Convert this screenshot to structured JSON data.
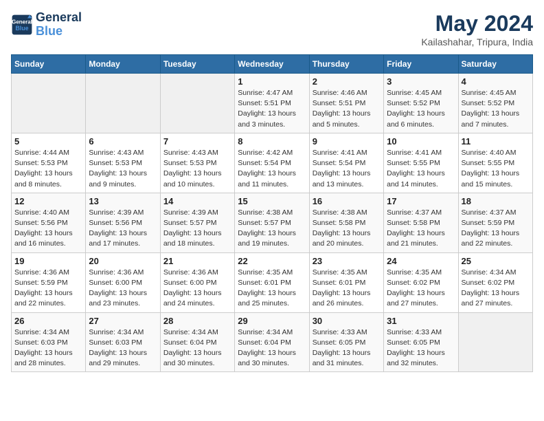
{
  "header": {
    "logo_line1": "General",
    "logo_line2": "Blue",
    "month_year": "May 2024",
    "location": "Kailashahar, Tripura, India"
  },
  "days_of_week": [
    "Sunday",
    "Monday",
    "Tuesday",
    "Wednesday",
    "Thursday",
    "Friday",
    "Saturday"
  ],
  "weeks": [
    [
      {
        "day": "",
        "info": ""
      },
      {
        "day": "",
        "info": ""
      },
      {
        "day": "",
        "info": ""
      },
      {
        "day": "1",
        "info": "Sunrise: 4:47 AM\nSunset: 5:51 PM\nDaylight: 13 hours and 3 minutes."
      },
      {
        "day": "2",
        "info": "Sunrise: 4:46 AM\nSunset: 5:51 PM\nDaylight: 13 hours and 5 minutes."
      },
      {
        "day": "3",
        "info": "Sunrise: 4:45 AM\nSunset: 5:52 PM\nDaylight: 13 hours and 6 minutes."
      },
      {
        "day": "4",
        "info": "Sunrise: 4:45 AM\nSunset: 5:52 PM\nDaylight: 13 hours and 7 minutes."
      }
    ],
    [
      {
        "day": "5",
        "info": "Sunrise: 4:44 AM\nSunset: 5:53 PM\nDaylight: 13 hours and 8 minutes."
      },
      {
        "day": "6",
        "info": "Sunrise: 4:43 AM\nSunset: 5:53 PM\nDaylight: 13 hours and 9 minutes."
      },
      {
        "day": "7",
        "info": "Sunrise: 4:43 AM\nSunset: 5:53 PM\nDaylight: 13 hours and 10 minutes."
      },
      {
        "day": "8",
        "info": "Sunrise: 4:42 AM\nSunset: 5:54 PM\nDaylight: 13 hours and 11 minutes."
      },
      {
        "day": "9",
        "info": "Sunrise: 4:41 AM\nSunset: 5:54 PM\nDaylight: 13 hours and 13 minutes."
      },
      {
        "day": "10",
        "info": "Sunrise: 4:41 AM\nSunset: 5:55 PM\nDaylight: 13 hours and 14 minutes."
      },
      {
        "day": "11",
        "info": "Sunrise: 4:40 AM\nSunset: 5:55 PM\nDaylight: 13 hours and 15 minutes."
      }
    ],
    [
      {
        "day": "12",
        "info": "Sunrise: 4:40 AM\nSunset: 5:56 PM\nDaylight: 13 hours and 16 minutes."
      },
      {
        "day": "13",
        "info": "Sunrise: 4:39 AM\nSunset: 5:56 PM\nDaylight: 13 hours and 17 minutes."
      },
      {
        "day": "14",
        "info": "Sunrise: 4:39 AM\nSunset: 5:57 PM\nDaylight: 13 hours and 18 minutes."
      },
      {
        "day": "15",
        "info": "Sunrise: 4:38 AM\nSunset: 5:57 PM\nDaylight: 13 hours and 19 minutes."
      },
      {
        "day": "16",
        "info": "Sunrise: 4:38 AM\nSunset: 5:58 PM\nDaylight: 13 hours and 20 minutes."
      },
      {
        "day": "17",
        "info": "Sunrise: 4:37 AM\nSunset: 5:58 PM\nDaylight: 13 hours and 21 minutes."
      },
      {
        "day": "18",
        "info": "Sunrise: 4:37 AM\nSunset: 5:59 PM\nDaylight: 13 hours and 22 minutes."
      }
    ],
    [
      {
        "day": "19",
        "info": "Sunrise: 4:36 AM\nSunset: 5:59 PM\nDaylight: 13 hours and 22 minutes."
      },
      {
        "day": "20",
        "info": "Sunrise: 4:36 AM\nSunset: 6:00 PM\nDaylight: 13 hours and 23 minutes."
      },
      {
        "day": "21",
        "info": "Sunrise: 4:36 AM\nSunset: 6:00 PM\nDaylight: 13 hours and 24 minutes."
      },
      {
        "day": "22",
        "info": "Sunrise: 4:35 AM\nSunset: 6:01 PM\nDaylight: 13 hours and 25 minutes."
      },
      {
        "day": "23",
        "info": "Sunrise: 4:35 AM\nSunset: 6:01 PM\nDaylight: 13 hours and 26 minutes."
      },
      {
        "day": "24",
        "info": "Sunrise: 4:35 AM\nSunset: 6:02 PM\nDaylight: 13 hours and 27 minutes."
      },
      {
        "day": "25",
        "info": "Sunrise: 4:34 AM\nSunset: 6:02 PM\nDaylight: 13 hours and 27 minutes."
      }
    ],
    [
      {
        "day": "26",
        "info": "Sunrise: 4:34 AM\nSunset: 6:03 PM\nDaylight: 13 hours and 28 minutes."
      },
      {
        "day": "27",
        "info": "Sunrise: 4:34 AM\nSunset: 6:03 PM\nDaylight: 13 hours and 29 minutes."
      },
      {
        "day": "28",
        "info": "Sunrise: 4:34 AM\nSunset: 6:04 PM\nDaylight: 13 hours and 30 minutes."
      },
      {
        "day": "29",
        "info": "Sunrise: 4:34 AM\nSunset: 6:04 PM\nDaylight: 13 hours and 30 minutes."
      },
      {
        "day": "30",
        "info": "Sunrise: 4:33 AM\nSunset: 6:05 PM\nDaylight: 13 hours and 31 minutes."
      },
      {
        "day": "31",
        "info": "Sunrise: 4:33 AM\nSunset: 6:05 PM\nDaylight: 13 hours and 32 minutes."
      },
      {
        "day": "",
        "info": ""
      }
    ]
  ]
}
